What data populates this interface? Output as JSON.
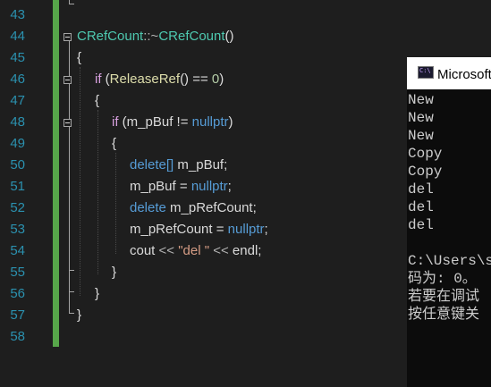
{
  "editor": {
    "line_numbers": [
      "43",
      "44",
      "45",
      "46",
      "47",
      "48",
      "49",
      "50",
      "51",
      "52",
      "53",
      "54",
      "55",
      "56",
      "57",
      "58"
    ],
    "colors": {
      "change_bar": "#57a64a",
      "line_number": "#2b91af",
      "background": "#1e1e1e"
    },
    "lines": {
      "l44": {
        "cls": "CRefCount",
        "sep": "::~",
        "fn": "CRefCount",
        "rest": "()"
      },
      "l45": {
        "text": "{"
      },
      "l46": {
        "kw": "if",
        "p1": " (",
        "fn": "ReleaseRef",
        "p2": "() == ",
        "num": "0",
        "p3": ")"
      },
      "l47": {
        "text": "{"
      },
      "l48": {
        "kw": "if",
        "p1": " (",
        "var": "m_pBuf",
        "p2": " != ",
        "kw2": "nullptr",
        "p3": ")"
      },
      "l49": {
        "text": "{"
      },
      "l50": {
        "kw": "delete[]",
        "var": " m_pBuf",
        "p": ";"
      },
      "l51": {
        "var": "m_pBuf",
        "p1": " = ",
        "kw": "nullptr",
        "p2": ";"
      },
      "l52": {
        "kw": "delete",
        "var": " m_pRefCount",
        "p": ";"
      },
      "l53": {
        "var": "m_pRefCount",
        "p1": " = ",
        "kw": "nullptr",
        "p2": ";"
      },
      "l54": {
        "id1": "cout",
        "op1": " << ",
        "str": "\"del \"",
        "op2": " << ",
        "id2": "endl",
        "p": ";"
      },
      "l55": {
        "text": "}"
      },
      "l56": {
        "text": "}"
      },
      "l57": {
        "text": "}"
      }
    }
  },
  "console": {
    "title": "Microsoft Visual Studio 调试控制台",
    "icon": "console-app-icon",
    "output": [
      "New",
      "New",
      "New",
      "Copy",
      "Copy",
      "del",
      "del",
      "del",
      "",
      "C:\\Users\\s",
      "码为: 0。",
      "若要在调试",
      "按任意键关"
    ]
  }
}
